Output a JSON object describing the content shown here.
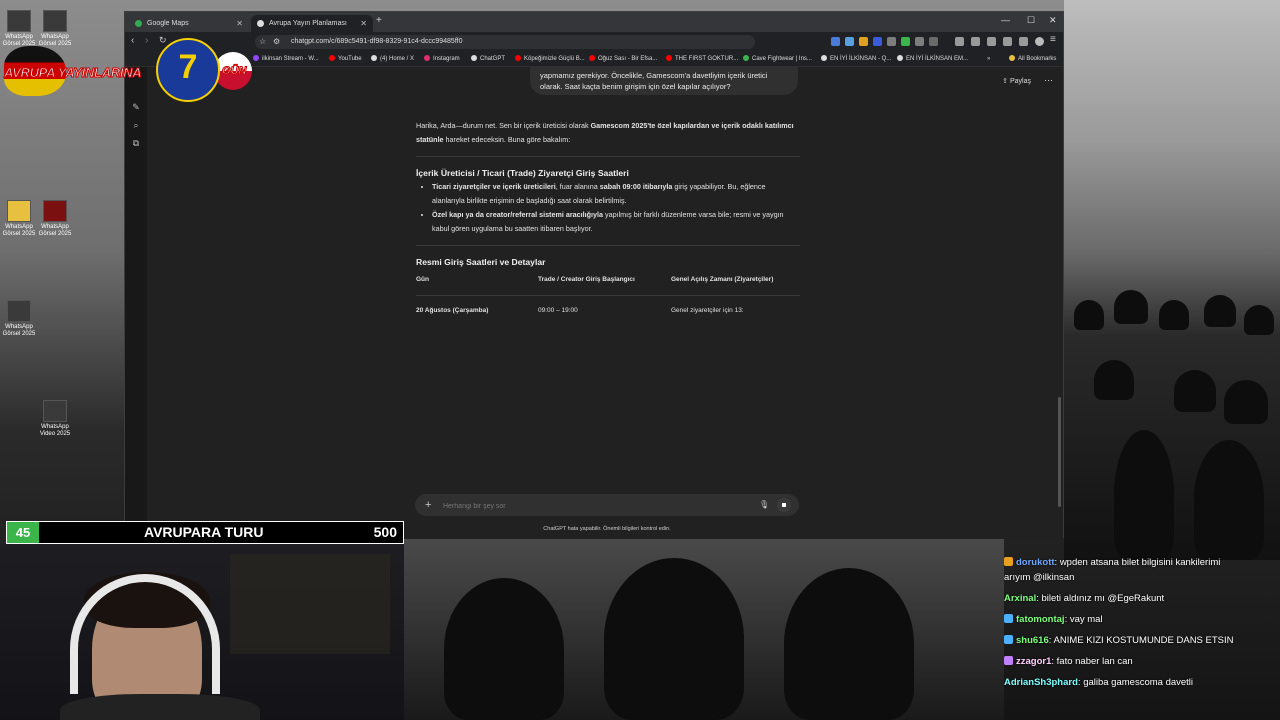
{
  "browser": {
    "tabs": [
      {
        "label": "Google Maps",
        "active": false
      },
      {
        "label": "Avrupa Yayın Planlaması",
        "active": true
      }
    ],
    "url": "chatgpt.com/c/689c5491-df98-8329-91c4-dccc99485ff0",
    "bookmarks": [
      "ilkinsan Stream - W...",
      "YouTube",
      "(4) Home / X",
      "Instagram",
      "ChatGPT",
      "Köpeğimizle Güçlü B...",
      "Oğuz Sası - Bir Efsa...",
      "THE FIRST GOKTUR...",
      "Cave Fightwear | Ins...",
      "EN İYİ İLKİNSAN - Q...",
      "EN İYİ İLKİNSAN EM...",
      "All Bookmarks"
    ]
  },
  "chatgpt": {
    "share_label": "Paylaş",
    "user_message": "yapmamız gerekiyor. Öncelikle, Gamescom'a davetliyim içerik üretici olarak. Saat kaçta benim girişim için özel kapılar açılıyor?",
    "intro_plain1": "Harika, Arda—durum net. Sen bir içerik üreticisi olarak ",
    "intro_bold": "Gamescom 2025'te özel kapılardan ve içerik odaklı katılımcı statünle",
    "intro_plain2": " hareket edeceksin. Buna göre bakalım:",
    "section1_title": "İçerik Üreticisi / Ticari (Trade) Ziyaretçi Giriş Saatleri",
    "bullet1_bold": "Ticari ziyaretçiler ve içerik üreticileri",
    "bullet1_plain1": ", fuar alanına ",
    "bullet1_bold2": "sabah 09:00 itibarıyla",
    "bullet1_plain2": " giriş yapabiliyor. Bu, eğlence alanlarıyla birlikte erişimin de başladığı saat olarak belirtilmiş.",
    "bullet2_bold": "Özel kapı ya da creator/referral sistemi aracılığıyla",
    "bullet2_plain": " yapılmış bir farklı düzenleme varsa bile; resmi ve yaygın kabul gören uygulama bu saatten itibaren başlıyor.",
    "section2_title": "Resmi Giriş Saatleri ve Detaylar",
    "table_headers": [
      "Gün",
      "Trade / Creator Giriş Başlangıcı",
      "Genel Açılış Zamanı (Ziyaretçiler)"
    ],
    "table_row": [
      "20 Ağustos (Çarşamba)",
      "09:00 – 19:00",
      "Genel ziyaretçiler için 13:"
    ],
    "composer_placeholder": "Herhangi bir şey sor",
    "disclaimer": "ChatGPT hata yapabilir. Önemli bilgileri kontrol edin."
  },
  "overlay": {
    "banner_text": "AVRUPA YAYINLARINA",
    "banner_number": "7",
    "banner_suffix": "GÜN",
    "counter_number": "45",
    "counter_title": "AVRUPARA TURU",
    "counter_value": "500"
  },
  "twitch_chat": [
    {
      "user": "dorukott",
      "text": "wpden atsana bilet bilgisini kankilerimi",
      "color": "#6fa8ff"
    },
    {
      "user": "",
      "text": "arıyım @ilkinsan",
      "color": "#ffffff"
    },
    {
      "user": "Arxinal",
      "text": "bileti aldınız mı @EgeRakunt",
      "color": "#7dff7d"
    },
    {
      "user": "fatomontaj",
      "text": "vay mal",
      "color": "#7dff7d"
    },
    {
      "user": "shu616",
      "text": "ANIME KIZI KOSTUMUNDE DANS ETSIN",
      "color": "#7dff7d"
    },
    {
      "user": "zzagor1",
      "text": "fato naber lan can",
      "color": "#ffd1ff"
    },
    {
      "user": "AdrianSh3phard",
      "text": "galiba gamescoma davetli",
      "color": "#7dffff"
    }
  ],
  "desktop_icons_left": [
    "WhatsApp Görsel 2025",
    "WhatsApp Görsel 2025",
    "WhatsApp Görsel 2025",
    "WhatsApp Görsel 2025",
    "WhatsApp Görsel 2025",
    "WhatsApp Video 2025"
  ]
}
